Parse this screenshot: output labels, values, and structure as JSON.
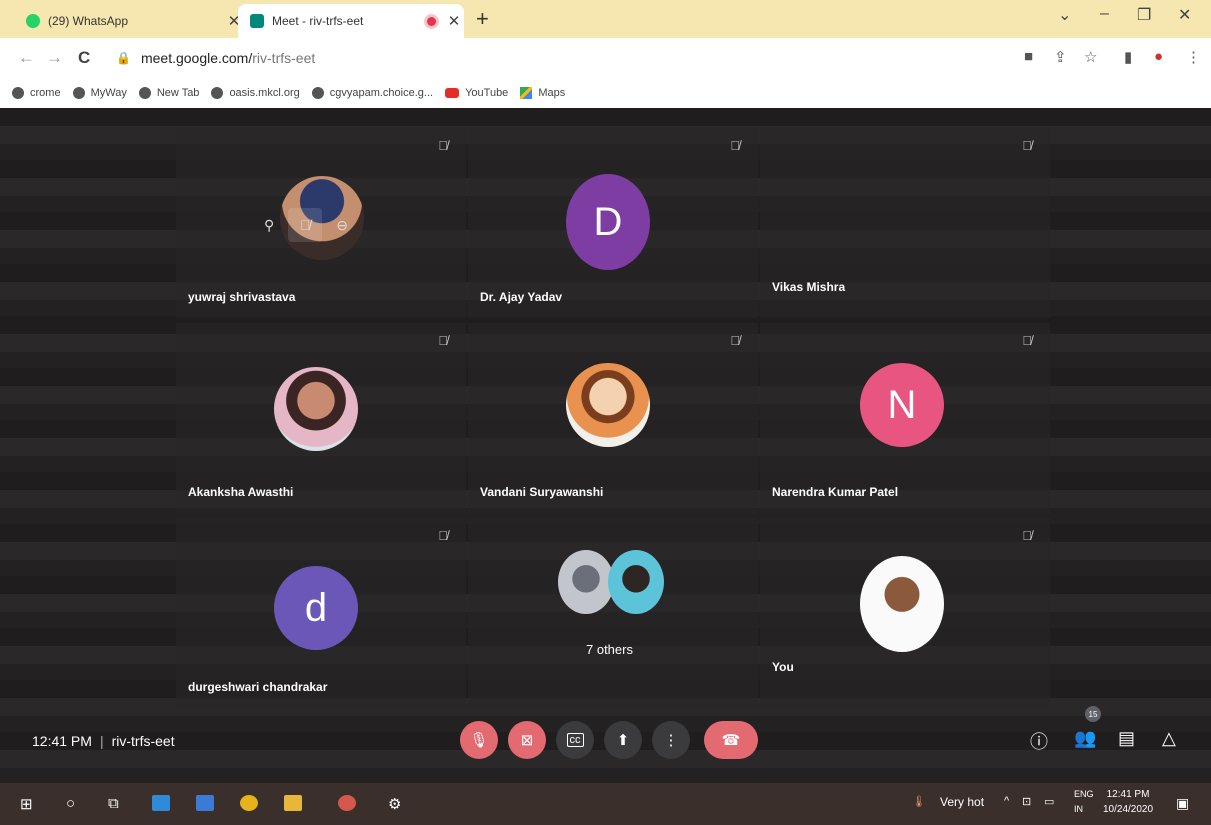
{
  "browser": {
    "tabs": [
      {
        "title": "(29) WhatsApp",
        "favicon_color": "#25d366",
        "active": false
      },
      {
        "title": "Meet - riv-trfs-eet",
        "favicon_color": "#00897b",
        "active": true,
        "recording": true
      }
    ],
    "url_host": "meet.google.com/",
    "url_path": "riv-trfs-eet",
    "bookmarks": [
      {
        "label": "crome",
        "icon": "globe-icon"
      },
      {
        "label": "MyWay",
        "icon": "globe-icon"
      },
      {
        "label": "New Tab",
        "icon": "globe-icon"
      },
      {
        "label": "oasis.mkcl.org",
        "icon": "globe-icon"
      },
      {
        "label": "cgvyapam.choice.g...",
        "icon": "globe-icon"
      },
      {
        "label": "YouTube",
        "icon": "youtube-icon"
      },
      {
        "label": "Maps",
        "icon": "maps-icon"
      }
    ]
  },
  "participants": [
    {
      "name": "yuwraj shrivastava",
      "type": "photo"
    },
    {
      "name": "Dr. Ajay Yadav",
      "type": "letter",
      "letter": "D",
      "color": "#7e3da3"
    },
    {
      "name": "Vikas Mishra",
      "type": "none"
    },
    {
      "name": "Akanksha Awasthi",
      "type": "photo"
    },
    {
      "name": "Vandani Suryawanshi",
      "type": "photo"
    },
    {
      "name": "Narendra Kumar Patel",
      "type": "letter",
      "letter": "N",
      "color": "#e85580"
    },
    {
      "name": "durgeshwari chandrakar",
      "type": "letter",
      "letter": "d",
      "color": "#6b57b8"
    },
    {
      "name": "",
      "type": "others",
      "label": "7 others"
    },
    {
      "name": "You",
      "type": "photo"
    }
  ],
  "meeting": {
    "time": "12:41 PM",
    "code": "riv-trfs-eet",
    "people_count": "15"
  },
  "taskbar": {
    "weather": "Very hot",
    "lang_top": "ENG",
    "lang_bottom": "IN",
    "time": "12:41 PM",
    "date": "10/24/2020"
  }
}
